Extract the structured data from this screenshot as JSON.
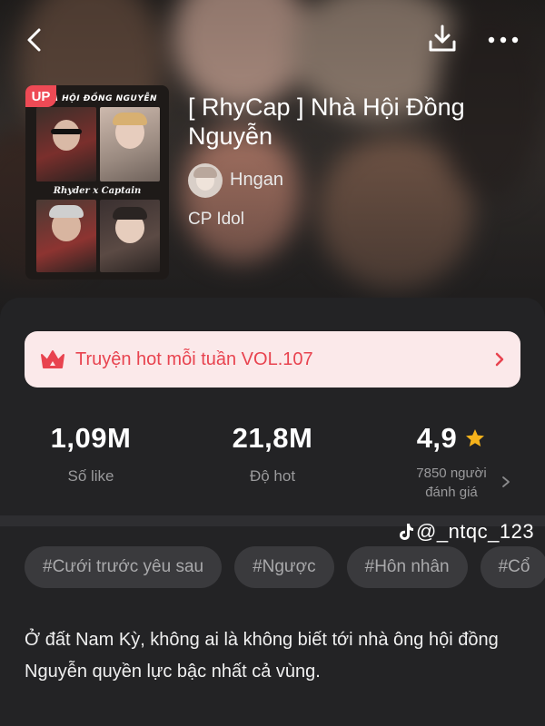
{
  "header": {
    "back_icon": "chevron-left-icon",
    "download_icon": "download-icon",
    "more_icon": "more-horizontal-icon"
  },
  "book": {
    "title": "[ RhyCap ] Nhà Hội Đồng Nguyễn",
    "badge": "UP",
    "cover_title": "NHÀ HỘI ĐỒNG NGUYỄN",
    "cover_subtitle": "Rhyder x Captain",
    "author": "Hngan",
    "category": "CP Idol"
  },
  "banner": {
    "text": "Truyện hot mỗi tuần VOL.107",
    "icon": "crown-icon",
    "bg_color": "#fbe9ea",
    "text_color": "#e8434f"
  },
  "stats": {
    "likes": {
      "value": "1,09M",
      "label": "Số like"
    },
    "hot": {
      "value": "21,8M",
      "label": "Độ hot"
    },
    "rating": {
      "value": "4,9",
      "count_line1": "7850 người",
      "count_line2": "đánh giá",
      "star_color": "#f5b21b"
    }
  },
  "watermark": "@_ntqc_123",
  "tags": [
    "#Cưới trước yêu sau",
    "#Ngược",
    "#Hôn nhân",
    "#Cổ"
  ],
  "description": "Ở đất Nam Kỳ, không ai là không biết tới nhà ông hội đồng Nguyễn quyền lực bậc nhất cả vùng."
}
